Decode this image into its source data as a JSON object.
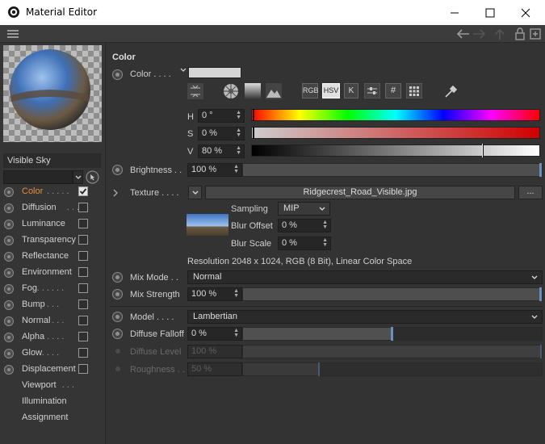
{
  "window": {
    "title": "Material Editor",
    "minimize": "—",
    "maximize": "☐",
    "close": "✕"
  },
  "preview": {
    "name_field": "Visible Sky"
  },
  "channels": [
    {
      "label": "Color",
      "dots": " . . . . .",
      "checked": true,
      "active": true
    },
    {
      "label": "Diffusion",
      "dots": " . . .",
      "checked": false
    },
    {
      "label": "Luminance",
      "dots": "",
      "checked": false
    },
    {
      "label": "Transparency",
      "dots": "",
      "checked": false
    },
    {
      "label": "Reflectance",
      "dots": "",
      "checked": false
    },
    {
      "label": "Environment",
      "dots": "",
      "checked": false
    },
    {
      "label": "Fog",
      "dots": " . . . . . .",
      "checked": false
    },
    {
      "label": "Bump",
      "dots": " . . . .",
      "checked": false
    },
    {
      "label": "Normal",
      "dots": " . . .",
      "checked": false
    },
    {
      "label": "Alpha",
      "dots": " . . . .",
      "checked": false
    },
    {
      "label": "Glow",
      "dots": " . . . .",
      "checked": false
    },
    {
      "label": "Displacement",
      "dots": "",
      "checked": false
    },
    {
      "label": "Viewport",
      "dots": " . . .",
      "checked": null
    },
    {
      "label": "Illumination",
      "dots": "",
      "checked": null
    },
    {
      "label": "Assignment",
      "dots": "",
      "checked": null
    }
  ],
  "section": {
    "title": "Color"
  },
  "color": {
    "label": "Color . . . .",
    "swatch": "#d6d6d6",
    "modes": [
      "RGB",
      "HSV",
      "K",
      "#"
    ],
    "h_label": "H",
    "h_value": "0 °",
    "s_label": "S",
    "s_value": "0 %",
    "v_label": "V",
    "v_value": "80 %",
    "v_level": 0.8
  },
  "brightness": {
    "label": "Brightness . .",
    "value": "100 %",
    "level": 1.0
  },
  "texture": {
    "label": "Texture . . . .",
    "file": "Ridgecrest_Road_Visible.jpg",
    "more": "...",
    "sampling_label": "Sampling",
    "sampling_value": "MIP",
    "blur_offset_label": "Blur Offset",
    "blur_offset_value": "0 %",
    "blur_scale_label": "Blur Scale",
    "blur_scale_value": "0 %",
    "resolution": "Resolution 2048 x 1024, RGB (8 Bit), Linear Color Space"
  },
  "mix_mode": {
    "label": "Mix Mode . .",
    "value": "Normal"
  },
  "mix_strength": {
    "label": "Mix Strength",
    "value": "100 %",
    "level": 1.0
  },
  "model": {
    "label": "Model . . . .",
    "value": "Lambertian"
  },
  "diffuse_falloff": {
    "label": "Diffuse Falloff",
    "value": "0 %",
    "level": 0.5
  },
  "diffuse_level": {
    "label": "Diffuse Level",
    "value": "100 %",
    "level": 1.0
  },
  "roughness": {
    "label": "Roughness . .",
    "value": "50 %",
    "level": 0.25
  }
}
